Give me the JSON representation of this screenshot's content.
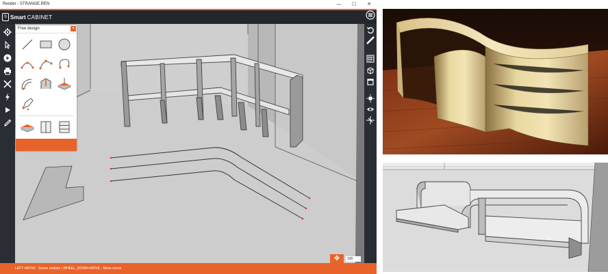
{
  "window": {
    "title": "Render - STRANGE.REN",
    "controls": [
      "—",
      "☐",
      "✕"
    ]
  },
  "app": {
    "brand_bold": "Smart",
    "brand_light": "CABINET"
  },
  "left_toolbar": {
    "items": [
      "gear-icon",
      "pointer-icon",
      "play-icon",
      "print-icon",
      "tools-icon",
      "lightning-icon",
      "cursor-icon",
      "pencil-icon"
    ]
  },
  "right_toolbar": {
    "items": [
      "menu-icon",
      "undo-icon",
      "measure-icon",
      "grid-view-icon",
      "cube-view-icon",
      "front-view-icon",
      "light-icon",
      "eye-icon",
      "axis-icon"
    ]
  },
  "free_design_panel": {
    "title": "Free design",
    "close": "×",
    "tools": [
      "line-tool-icon",
      "rectangle-tool-icon",
      "circle-tool-icon",
      "arc-tool-icon",
      "curve-tool-icon",
      "bezier-tool-icon",
      "offset-tool-icon",
      "extrude-tool-icon",
      "board-tool-icon",
      "pen-tool-icon"
    ],
    "library": [
      "panel-library-icon",
      "door-library-icon",
      "drawer-library-icon"
    ]
  },
  "viewport": {
    "zoom_value": "100",
    "move_icon": "move-arrows-icon"
  },
  "status": {
    "text": "LEFT+MOVE : Scene rotation  |  WHEEL_DOWN+MOVE : Move scene"
  },
  "colors": {
    "accent": "#e8632a",
    "toolbar": "#2a2d33",
    "viewport": "#cfcfcf"
  }
}
